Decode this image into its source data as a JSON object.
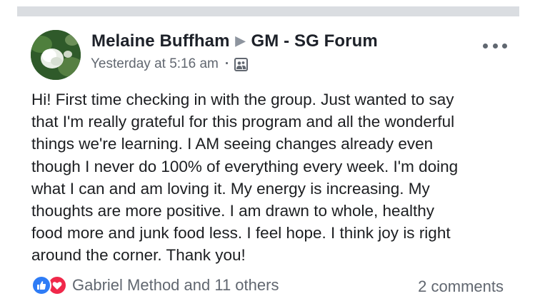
{
  "post": {
    "author": "Melaine Buffham",
    "group": "GM - SG Forum",
    "timestamp": "Yesterday at 5:16 am",
    "separator": "·",
    "audience_icon": "group-audience-icon",
    "more_icon": "more-options-icon",
    "body_lines": [
      "Hi! First time checking in with the group. Just wanted to say",
      "that I'm really grateful for this program and all the wonderful",
      "things we're learning. I AM seeing changes already even",
      "though I never do 100% of everything every week. I'm doing",
      "what I can and am loving it. My energy is increasing. My",
      "thoughts are more positive. I am drawn to whole, healthy",
      "food more and junk food less. I feel hope. I think joy is right",
      "around the corner. Thank you!"
    ]
  },
  "footer": {
    "reactions_text": "Gabriel Method and 11 others",
    "comments_text": "2 comments",
    "reaction_icons": [
      "like-icon",
      "love-icon"
    ]
  },
  "colors": {
    "like_blue": "#2e7cf6",
    "love_red": "#f0284a",
    "meta_gray": "#616770",
    "divider_gray": "#dadde1"
  }
}
